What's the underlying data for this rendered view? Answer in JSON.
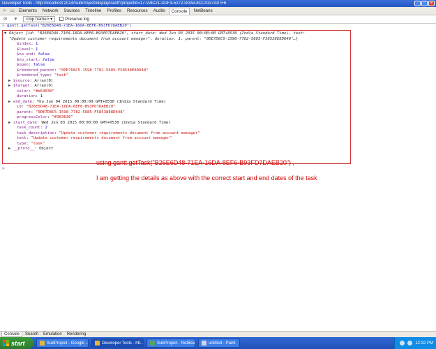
{
  "window": {
    "title": "Developer Tools - http://localhost:2014/SubProject/displayGantt?projectId=177A9C21-DDF3-5272-D0A8-8CC4137A07F6"
  },
  "toolbar": {
    "tabs": [
      "Elements",
      "Network",
      "Sources",
      "Timeline",
      "Profiles",
      "Resources",
      "Audits",
      "Console",
      "NetBeans"
    ],
    "active_tab": "Console",
    "frame_selector": "<top frame>",
    "preserve_log": "Preserve log"
  },
  "console": {
    "command": "gantt.getTask(\"B26E6D48-71EA-16DA-8EF6-B93FD7DAEB20\")",
    "summary_line1": "Object {id: \"B26E6D48-71EA-16DA-8EF6-B93FD7DAEB20\", start_date: Wed Jun 03 2015 00:00:00 GMT+0530 (India Standard Time), text:",
    "summary_line2": "\"Update customer requirements document from account manager\", duration: 1, parent: \"0DE7D8C5-1598-7782-5685-F58538E8D648\"…}",
    "properties": [
      {
        "key": "$index",
        "value": "1",
        "kind": "num",
        "indent": 1,
        "expand": false
      },
      {
        "key": "$level",
        "value": "1",
        "kind": "num",
        "indent": 1,
        "expand": false
      },
      {
        "key": "$no_end",
        "value": "false",
        "kind": "num",
        "indent": 1,
        "expand": false
      },
      {
        "key": "$no_start",
        "value": "false",
        "kind": "num",
        "indent": 1,
        "expand": false
      },
      {
        "key": "$open",
        "value": "false",
        "kind": "num",
        "indent": 1,
        "expand": false
      },
      {
        "key": "$rendered_parent",
        "value": "\"0DE7D8C5-1598-7782-5685-F58538E8D648\"",
        "kind": "str",
        "indent": 1,
        "expand": false
      },
      {
        "key": "$rendered_type",
        "value": "\"task\"",
        "kind": "str",
        "indent": 1,
        "expand": false
      },
      {
        "key": "$source",
        "value": "Array[0]",
        "kind": "plain",
        "indent": 0,
        "expand": true
      },
      {
        "key": "$target",
        "value": "Array[0]",
        "kind": "plain",
        "indent": 0,
        "expand": true
      },
      {
        "key": "color",
        "value": "\"#e63030\"",
        "kind": "str",
        "indent": 1,
        "expand": false
      },
      {
        "key": "duration",
        "value": "1",
        "kind": "num",
        "indent": 1,
        "expand": false
      },
      {
        "key": "end_date",
        "value": "Thu Jun 04 2015 00:00:00 GMT+0530 (India Standard Time)",
        "kind": "plain",
        "indent": 0,
        "expand": true
      },
      {
        "key": "id",
        "value": "\"B26E6D48-71EA-16DA-8EF6-B93FD7DAEB20\"",
        "kind": "str",
        "indent": 1,
        "expand": false
      },
      {
        "key": "parent",
        "value": "\"0DE7D8C5-1598-7782-5685-F58538E8D648\"",
        "kind": "str",
        "indent": 1,
        "expand": false
      },
      {
        "key": "progressColor",
        "value": "\"#363636\"",
        "kind": "str",
        "indent": 1,
        "expand": false
      },
      {
        "key": "start_date",
        "value": "Wed Jun 03 2015 00:00:00 GMT+0530 (India Standard Time)",
        "kind": "plain",
        "indent": 0,
        "expand": true
      },
      {
        "key": "task_count",
        "value": "2",
        "kind": "num",
        "indent": 1,
        "expand": false
      },
      {
        "key": "task_description",
        "value": "\"Update customer requirements document from account manager\"",
        "kind": "str",
        "indent": 1,
        "expand": false
      },
      {
        "key": "text",
        "value": "\"Update customer requirements document from account manager\"",
        "kind": "str",
        "indent": 1,
        "expand": false
      },
      {
        "key": "type",
        "value": "\"task\"",
        "kind": "str",
        "indent": 1,
        "expand": false
      },
      {
        "key": "__proto__",
        "value": "Object",
        "kind": "plain",
        "indent": 0,
        "expand": true
      }
    ],
    "prompt": ">"
  },
  "annotations": {
    "line1": "using gantt.getTask(\"B26E6D48-71EA-16DA-8EF6-B93FD7DAEB20\") ,",
    "line2": "I am getting the details as above with the correct start and end dates of the task"
  },
  "drawer": {
    "tabs": [
      "Console",
      "Search",
      "Emulation",
      "Rendering"
    ],
    "active_tab": "Console"
  },
  "taskbar": {
    "start_label": "start",
    "buttons": [
      {
        "label": "SubProject - Google ...",
        "color": "#e8b53a",
        "active": false
      },
      {
        "label": "Developer Tools - htt...",
        "color": "#e8b53a",
        "active": true
      },
      {
        "label": "SubProject - NetBean...",
        "color": "#5ea05e",
        "active": false
      },
      {
        "label": "untitled - Paint",
        "color": "#d2d2f0",
        "active": false
      }
    ],
    "clock": "12:32 PM"
  },
  "colors": {
    "annotation_red": "#d40000",
    "box_border": "#cc3333",
    "key_purple": "#8a1d8a",
    "string_red": "#c41a16"
  }
}
